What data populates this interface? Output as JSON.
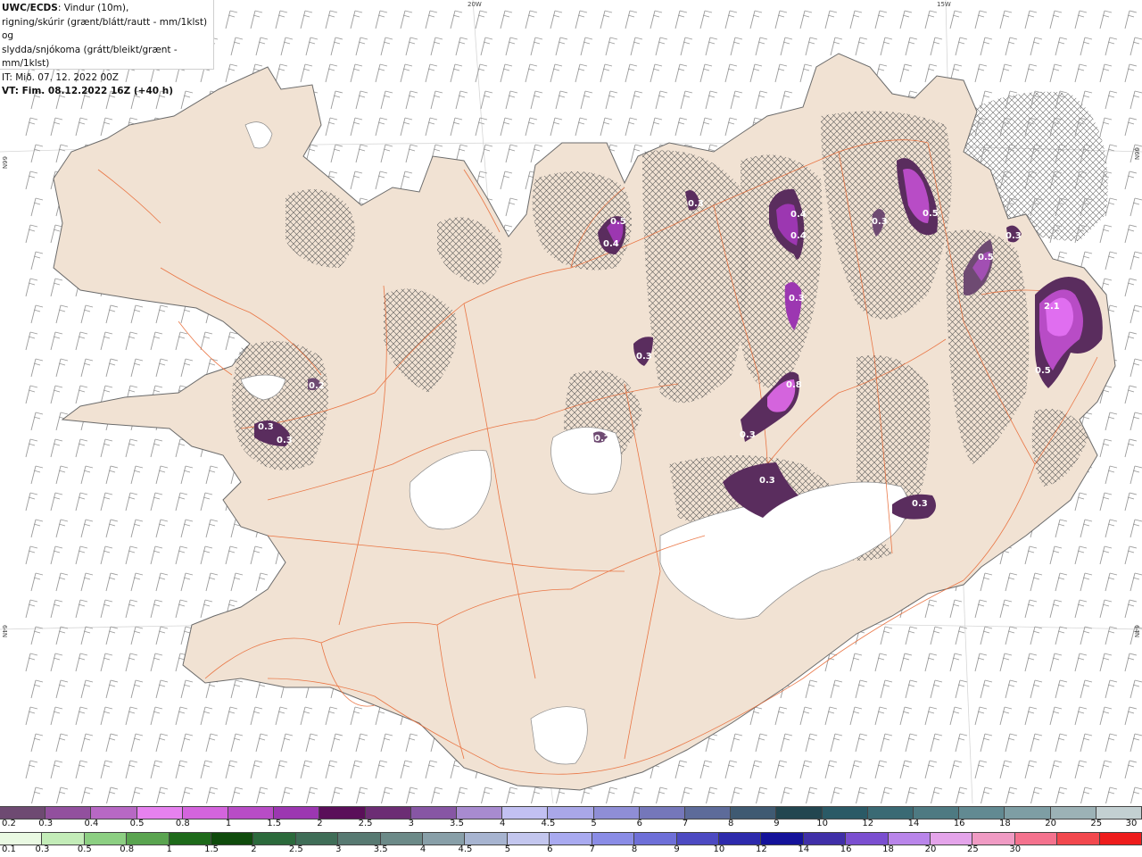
{
  "title": {
    "product": "UWC/ECDS",
    "line1_rest": ": Vindur (10m),",
    "line2": "rigning/skúrir (grænt/blátt/rautt - mm/1klst) og",
    "line3": "slydda/snjókoma (grátt/bleikt/grænt - mm/1klst)",
    "line4": "IT: Mið. 07. 12. 2022 00Z",
    "line5": "VT: Fim. 08.12.2022 16Z (+40 h)"
  },
  "grid_labels": {
    "lon_20w": "20W",
    "lon_15w": "15W",
    "lat_66n_left": "66N",
    "lat_66n_right": "66N",
    "lat_64n_left": "64N",
    "lat_64n_right": "64N"
  },
  "colors": {
    "land": "#f1e2d3",
    "ocean": "#ffffff",
    "roads": "#e8632c",
    "coast": "#6b6b6b",
    "glacier": "#ffffff",
    "hatch": "#555555",
    "snow_light": "#c983d9",
    "snow_mid": "#a24fb3",
    "snow_dark": "#5a2d5e",
    "snow_bright": "#e06ef0",
    "wind_barb": "#9a9a9a"
  },
  "precip_labels": [
    {
      "text": "0.5"
    },
    {
      "text": "0.4"
    },
    {
      "text": "0.3"
    },
    {
      "text": "0.4"
    },
    {
      "text": "0.4"
    },
    {
      "text": "0.3"
    },
    {
      "text": "0.3"
    },
    {
      "text": "0.8"
    },
    {
      "text": "0.3"
    },
    {
      "text": "0.3"
    },
    {
      "text": "0.5"
    },
    {
      "text": "0.3"
    },
    {
      "text": "0.5"
    },
    {
      "text": "2.1"
    },
    {
      "text": "0.5"
    },
    {
      "text": "0.3"
    },
    {
      "text": "0.3"
    },
    {
      "text": "0.3"
    },
    {
      "text": "0.3"
    },
    {
      "text": "0.2"
    },
    {
      "text": "0.2"
    }
  ],
  "legend_snow": {
    "colors": [
      "#6e4a72",
      "#92509e",
      "#b768c4",
      "#e681ef",
      "#d464dd",
      "#b84cc6",
      "#9c37b1",
      "#5a0f59",
      "#6c2d74",
      "#8756a4",
      "#a88bd0",
      "#c2c0f2",
      "#a9a7e8",
      "#8f8ed6",
      "#7577ba",
      "#5d6b9a",
      "#3f5a72",
      "#224650",
      "#2a5a66",
      "#3a6a74",
      "#4e7a82",
      "#628a92",
      "#7e9ea4",
      "#9cb2b6",
      "#c3d0d2"
    ],
    "ticks": [
      "0.2",
      "0.3",
      "0.4",
      "0.5",
      "0.8",
      "1",
      "1.5",
      "2",
      "2.5",
      "3",
      "3.5",
      "4",
      "4.5",
      "5",
      "6",
      "7",
      "8",
      "9",
      "10",
      "12",
      "14",
      "16",
      "18",
      "20",
      "25",
      "30"
    ]
  },
  "legend_rain": {
    "colors": [
      "#e9f9e2",
      "#c3ecb8",
      "#8ccf82",
      "#5aa450",
      "#1e6a1a",
      "#0f4b0c",
      "#2c6a3c",
      "#406e58",
      "#587a72",
      "#6c8a88",
      "#889fa8",
      "#a7b4d0",
      "#c3c6ee",
      "#a9aaf0",
      "#8a8ce6",
      "#6e6fd8",
      "#4d4ac2",
      "#2d2aac",
      "#14129a",
      "#402fa8",
      "#7b4fd0",
      "#b985ea",
      "#e4a4ea",
      "#f09bc4",
      "#f4728e",
      "#f2484e",
      "#ee1c1c"
    ],
    "ticks": [
      "0.1",
      "0.3",
      "0.5",
      "0.8",
      "1",
      "1.5",
      "2",
      "2.5",
      "3",
      "3.5",
      "4",
      "4.5",
      "5",
      "6",
      "7",
      "8",
      "9",
      "10",
      "12",
      "14",
      "16",
      "18",
      "20",
      "25",
      "30"
    ]
  }
}
